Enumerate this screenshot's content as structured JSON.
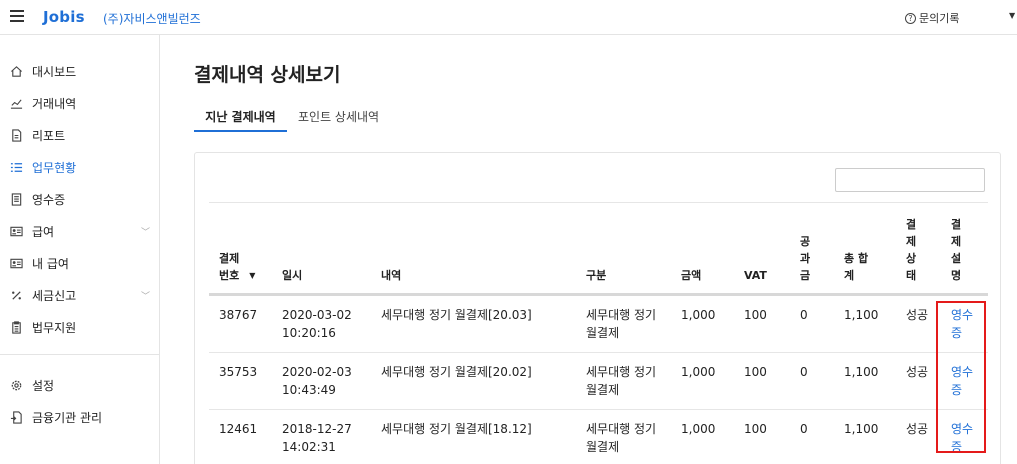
{
  "header": {
    "logo": "Jobis",
    "company": "(주)자비스앤빌런즈",
    "inquiry": "문의기록"
  },
  "sidebar": {
    "items": [
      {
        "label": "대시보드",
        "icon": "home-icon"
      },
      {
        "label": "거래내역",
        "icon": "chart-line-icon"
      },
      {
        "label": "리포트",
        "icon": "document-icon"
      },
      {
        "label": "업무현황",
        "icon": "list-icon",
        "active": true
      },
      {
        "label": "영수증",
        "icon": "receipt-icon"
      },
      {
        "label": "급여",
        "icon": "id-card-icon",
        "expandable": true
      },
      {
        "label": "내 급여",
        "icon": "id-card-icon"
      },
      {
        "label": "세금신고",
        "icon": "percent-icon",
        "expandable": true
      },
      {
        "label": "법무지원",
        "icon": "clipboard-icon"
      }
    ],
    "bottom_items": [
      {
        "label": "설정",
        "icon": "gear-icon"
      },
      {
        "label": "금융기관 관리",
        "icon": "document-link-icon"
      }
    ]
  },
  "page": {
    "title": "결제내역 상세보기",
    "tabs": [
      "지난 결제내역",
      "포인트 상세내역"
    ],
    "active_tab": 0
  },
  "table": {
    "headers": [
      "결제\n번호",
      "일시",
      "내역",
      "구분",
      "금액",
      "VAT",
      "공\n과\n금",
      "총 합\n계",
      "결\n제\n상\n태",
      "결\n제\n설\n명"
    ],
    "rows": [
      {
        "id": "38767",
        "datetime": "2020-03-02\n10:20:16",
        "description": "세무대행 정기 월결제[20.03]",
        "type": "세무대행 정기\n월결제",
        "amount": "1,000",
        "vat": "100",
        "utility": "0",
        "total": "1,100",
        "status": "성공",
        "receipt": "영수\n증"
      },
      {
        "id": "35753",
        "datetime": "2020-02-03\n10:43:49",
        "description": "세무대행 정기 월결제[20.02]",
        "type": "세무대행 정기\n월결제",
        "amount": "1,000",
        "vat": "100",
        "utility": "0",
        "total": "1,100",
        "status": "성공",
        "receipt": "영수\n증"
      },
      {
        "id": "12461",
        "datetime": "2018-12-27\n14:02:31",
        "description": "세무대행 정기 월결제[18.12]",
        "type": "세무대행 정기\n월결제",
        "amount": "1,000",
        "vat": "100",
        "utility": "0",
        "total": "1,100",
        "status": "성공",
        "receipt": "영수\n증"
      }
    ]
  },
  "colors": {
    "accent": "#1f6fd6",
    "highlight": "#e41a1a"
  }
}
